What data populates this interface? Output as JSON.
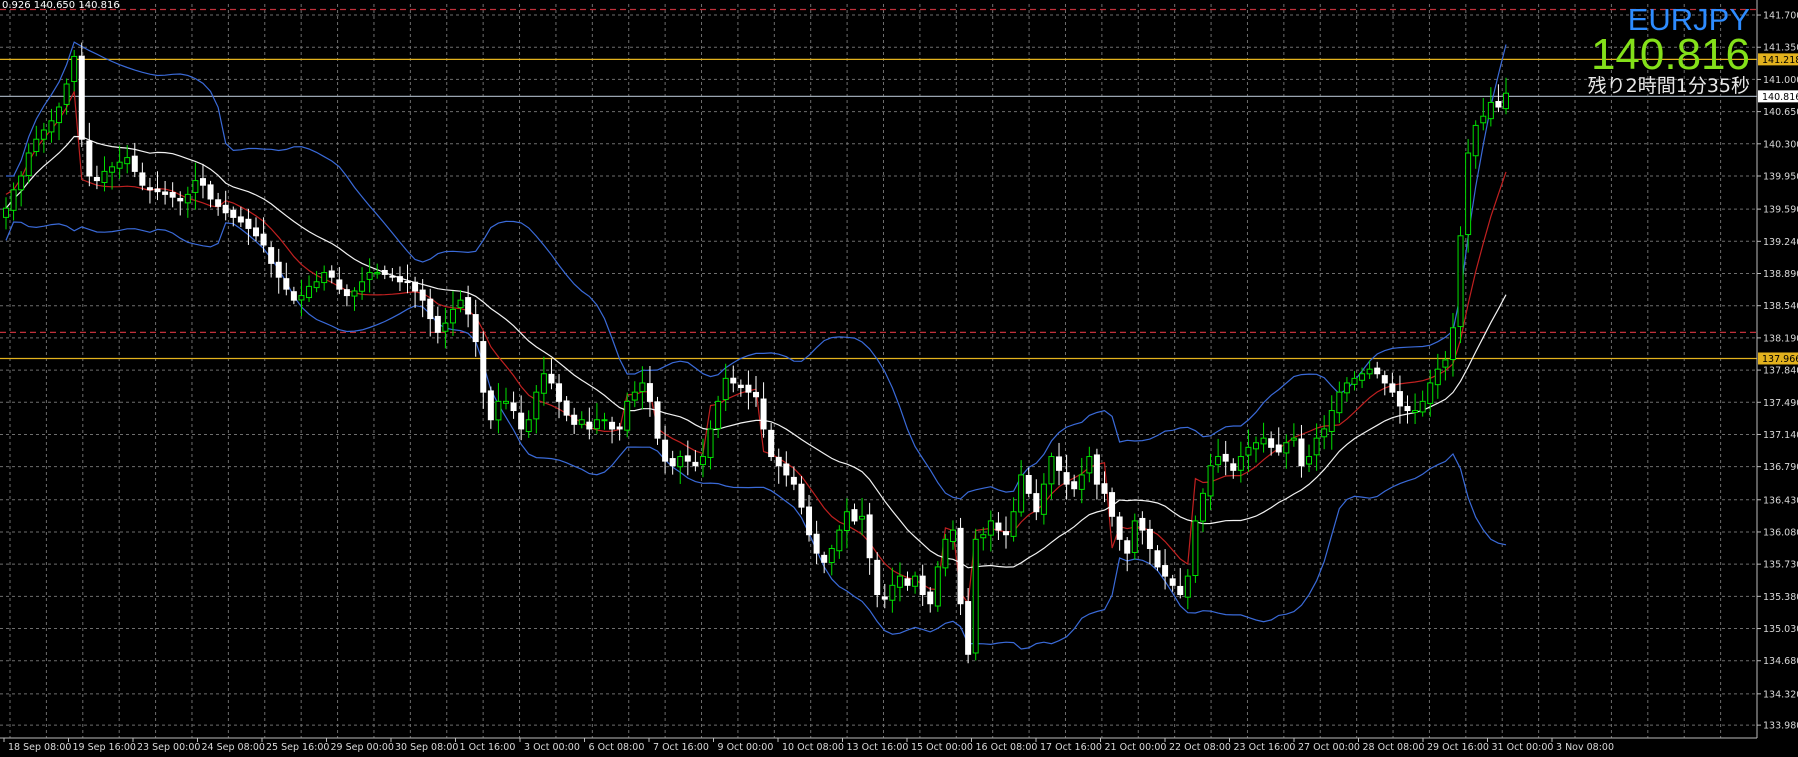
{
  "window": {
    "symbol": "EURJPY",
    "current_price": "140.816",
    "time_remaining": "残り2時間1分35秒",
    "ohlc_fragment": "0.926 140.650 140.816"
  },
  "chart_data": {
    "type": "candlestick",
    "symbol": "EURJPY",
    "ylim": [
      133.84,
      141.82
    ],
    "y_ticks": [
      "141.700",
      "141.350",
      "141.000",
      "140.650",
      "140.300",
      "139.950",
      "139.590",
      "139.240",
      "138.890",
      "138.540",
      "138.190",
      "137.840",
      "137.490",
      "137.140",
      "136.790",
      "136.430",
      "136.080",
      "135.730",
      "135.380",
      "135.030",
      "134.680",
      "134.320",
      "133.980"
    ],
    "x_labels": [
      "18 Sep 08:00",
      "19 Sep 16:00",
      "23 Sep 00:00",
      "24 Sep 08:00",
      "25 Sep 16:00",
      "29 Sep 00:00",
      "30 Sep 08:00",
      "1 Oct 16:00",
      "3 Oct 00:00",
      "6 Oct 08:00",
      "7 Oct 16:00",
      "9 Oct 00:00",
      "10 Oct 08:00",
      "13 Oct 16:00",
      "15 Oct 00:00",
      "16 Oct 08:00",
      "17 Oct 16:00",
      "21 Oct 00:00",
      "22 Oct 08:00",
      "23 Oct 16:00",
      "27 Oct 00:00",
      "28 Oct 08:00",
      "29 Oct 16:00",
      "31 Oct 00:00",
      "3 Nov 08:00"
    ],
    "price_tags": [
      {
        "label": "141.218",
        "value": 141.218,
        "kind": "level"
      },
      {
        "label": "140.816",
        "value": 140.816,
        "kind": "current"
      },
      {
        "label": "137.966",
        "value": 137.966,
        "kind": "level"
      }
    ],
    "horizontal_lines": [
      {
        "value": 141.218,
        "style": "solid",
        "color": "#e3b21e"
      },
      {
        "value": 137.966,
        "style": "solid",
        "color": "#e3b21e"
      },
      {
        "value": 140.816,
        "style": "solid",
        "color": "#9aa4b0"
      },
      {
        "value": 141.76,
        "style": "dashed",
        "color": "#c0303a"
      },
      {
        "value": 138.25,
        "style": "dashed",
        "color": "#c0303a"
      }
    ],
    "closes": [
      139.6,
      139.8,
      139.95,
      140.2,
      140.35,
      140.45,
      140.55,
      140.7,
      140.95,
      141.25,
      140.35,
      139.95,
      139.9,
      140.0,
      140.05,
      140.1,
      140.15,
      140.0,
      139.85,
      139.8,
      139.78,
      139.75,
      139.72,
      139.68,
      139.75,
      139.9,
      139.85,
      139.7,
      139.62,
      139.55,
      139.5,
      139.45,
      139.38,
      139.3,
      139.2,
      139.0,
      138.85,
      138.72,
      138.6,
      138.65,
      138.75,
      138.8,
      138.9,
      138.85,
      138.72,
      138.65,
      138.7,
      138.8,
      138.9,
      138.9,
      138.88,
      138.85,
      138.8,
      138.8,
      138.7,
      138.6,
      138.4,
      138.25,
      138.35,
      138.5,
      138.6,
      138.45,
      138.15,
      137.6,
      137.3,
      137.5,
      137.5,
      137.4,
      137.2,
      137.3,
      137.6,
      137.8,
      137.7,
      137.5,
      137.35,
      137.25,
      137.3,
      137.2,
      137.3,
      137.3,
      137.2,
      137.2,
      137.5,
      137.6,
      137.7,
      137.5,
      137.1,
      136.85,
      136.8,
      136.9,
      136.85,
      136.8,
      136.9,
      137.2,
      137.5,
      137.75,
      137.7,
      137.65,
      137.6,
      137.55,
      137.2,
      136.9,
      136.8,
      136.7,
      136.6,
      136.35,
      136.05,
      135.85,
      135.75,
      135.9,
      136.1,
      136.3,
      136.2,
      136.25,
      135.8,
      135.4,
      135.35,
      135.5,
      135.6,
      135.5,
      135.6,
      135.4,
      135.3,
      135.7,
      136.0,
      136.1,
      135.3,
      134.75,
      136.0,
      136.05,
      136.2,
      136.1,
      136.05,
      136.3,
      136.7,
      136.5,
      136.3,
      136.6,
      136.9,
      136.75,
      136.6,
      136.55,
      136.7,
      136.9,
      136.6,
      136.5,
      136.25,
      136.0,
      135.85,
      136.2,
      136.1,
      135.9,
      135.7,
      135.6,
      135.5,
      135.4,
      135.6,
      136.2,
      136.5,
      136.8,
      136.9,
      136.85,
      136.75,
      136.9,
      137.0,
      137.05,
      137.1,
      137.0,
      136.95,
      137.05,
      137.1,
      136.8,
      136.9,
      137.1,
      137.2,
      137.4,
      137.6,
      137.7,
      137.75,
      137.8,
      137.85,
      137.8,
      137.7,
      137.6,
      137.45,
      137.4,
      137.4,
      137.5,
      137.7,
      137.85,
      137.95,
      138.3,
      139.3,
      140.2,
      140.5,
      140.6,
      140.75,
      140.7,
      140.85
    ],
    "indicators": [
      {
        "name": "Bollinger upper",
        "color": "#3a6ad8"
      },
      {
        "name": "Bollinger middle",
        "color": "#f2f2f2"
      },
      {
        "name": "Bollinger lower",
        "color": "#3a6ad8"
      },
      {
        "name": "Bollinger inner",
        "color": "#c02020"
      }
    ],
    "grid": true,
    "colors": {
      "bull": "#00e000",
      "bear": "#ffffff",
      "background": "#000000",
      "grid": "#6e6e6e",
      "axis_text": "#d8d8d8"
    }
  }
}
